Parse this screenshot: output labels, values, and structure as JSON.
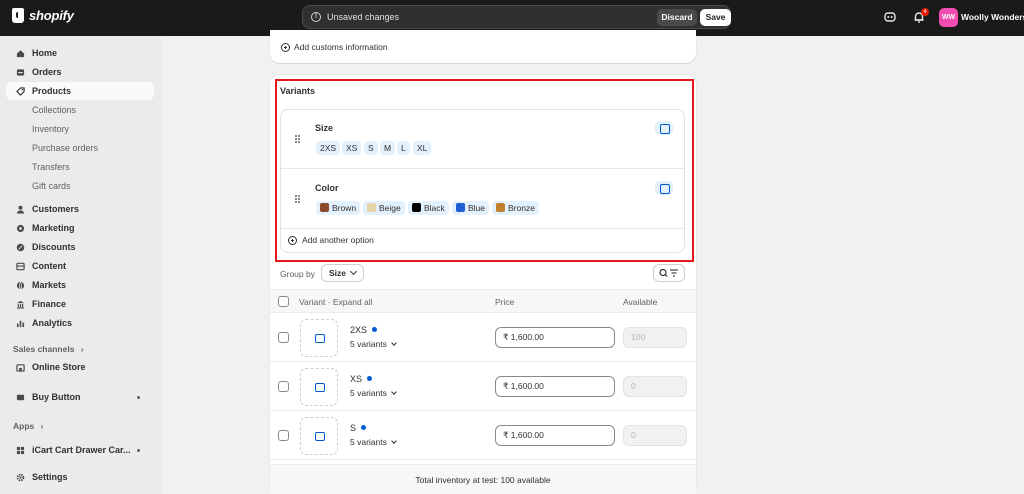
{
  "topbar": {
    "logo_text": "shopify",
    "unsaved_message": "Unsaved changes",
    "discard_label": "Discard",
    "save_label": "Save",
    "notification_count": "4",
    "avatar_initials": "WW",
    "store_name": "Woolly Wonders",
    "avatar_color": "#f14cb0"
  },
  "sidebar": {
    "items": [
      {
        "label": "Home",
        "icon": "home-icon"
      },
      {
        "label": "Orders",
        "icon": "orders-icon"
      },
      {
        "label": "Products",
        "icon": "tag-icon"
      },
      {
        "label": "Customers",
        "icon": "person-icon"
      },
      {
        "label": "Marketing",
        "icon": "target-icon"
      },
      {
        "label": "Discounts",
        "icon": "discount-icon"
      },
      {
        "label": "Content",
        "icon": "content-icon"
      },
      {
        "label": "Markets",
        "icon": "globe-icon"
      },
      {
        "label": "Finance",
        "icon": "bank-icon"
      },
      {
        "label": "Analytics",
        "icon": "bar-chart-icon"
      }
    ],
    "product_subitems": [
      "Collections",
      "Inventory",
      "Purchase orders",
      "Transfers",
      "Gift cards"
    ],
    "sales_channels_label": "Sales channels",
    "online_store_label": "Online Store",
    "buy_button_label": "Buy Button",
    "apps_label": "Apps",
    "icart_label": "iCart Cart Drawer Car...",
    "settings_label": "Settings"
  },
  "customs": {
    "add_label": "Add customs information"
  },
  "variants": {
    "title": "Variants",
    "options": [
      {
        "name": "Size",
        "values": [
          "2XS",
          "XS",
          "S",
          "M",
          "L",
          "XL"
        ]
      },
      {
        "name": "Color",
        "values": [
          {
            "label": "Brown",
            "color": "#8b4a2b"
          },
          {
            "label": "Beige",
            "color": "#e6d3a8"
          },
          {
            "label": "Black",
            "color": "#000000"
          },
          {
            "label": "Blue",
            "color": "#1f5fd6"
          },
          {
            "label": "Bronze",
            "color": "#c0802f"
          }
        ]
      }
    ],
    "add_option_label": "Add another option",
    "group_by_label": "Group by",
    "group_by_value": "Size",
    "table_headers": {
      "variant": "Variant · Expand all",
      "price": "Price",
      "available": "Available"
    },
    "rows": [
      {
        "name": "2XS",
        "count": "5 variants",
        "price": "₹  1,600.00",
        "available": "100"
      },
      {
        "name": "XS",
        "count": "5 variants",
        "price": "₹  1,600.00",
        "available": "0"
      },
      {
        "name": "S",
        "count": "5 variants",
        "price": "₹  1,600.00",
        "available": "0"
      }
    ],
    "total_inventory": "Total inventory at test: 100 available"
  },
  "highlight_color": "#e3161b"
}
